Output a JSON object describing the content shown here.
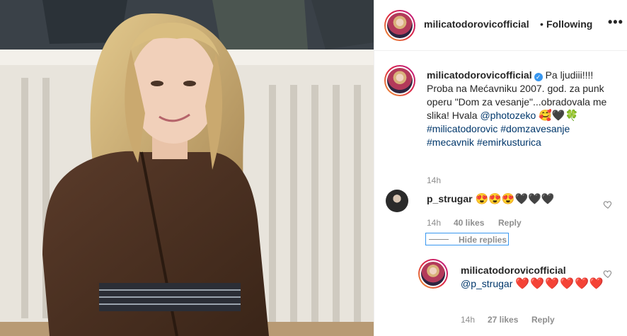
{
  "post": {
    "username": "milicatodorovicofficial",
    "follow_separator": "•",
    "follow_status": "Following",
    "more_label": "•••"
  },
  "caption": {
    "username": "milicatodorovicofficial",
    "verified_mark": "✓",
    "text_before": "Pa ljudiii!!!! Proba na Mećavniku 2007. god. za punk operu \"Dom za vesanje\"...obradovala me slika! Hvala ",
    "mention": "@photozeko",
    "emojis": "🥰🖤🍀",
    "hashtags": [
      "#milicatodorovic",
      "#domzavesanje",
      "#mecavnik",
      "#emirkusturica"
    ],
    "time": "14h"
  },
  "comments": [
    {
      "username": "p_strugar",
      "text": "😍😍😍🖤🖤🖤",
      "time": "14h",
      "likes": "40 likes",
      "reply_label": "Reply",
      "hide_replies_label": "Hide replies",
      "replies": [
        {
          "username": "milicatodorovicofficial",
          "mention": "@p_strugar",
          "hearts": "❤️❤️❤️❤️❤️❤️",
          "time": "14h",
          "likes": "27 likes",
          "reply_label": "Reply"
        }
      ]
    }
  ],
  "colors": {
    "link": "#00376b",
    "muted": "#8e8e8e",
    "verified": "#3897f0",
    "heart": "#ed4956"
  },
  "icons": [
    "verified-badge-icon",
    "heart-outline-icon",
    "more-options-icon"
  ]
}
